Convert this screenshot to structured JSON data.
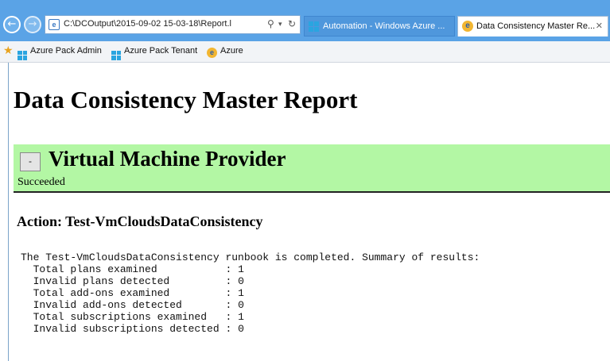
{
  "browser": {
    "address": "C:\\DCOutput\\2015-09-02 15-03-18\\Report.l",
    "tabs": [
      {
        "label": "Automation - Windows Azure ...",
        "active": false,
        "icon": "azure-icon"
      },
      {
        "label": "Data Consistency Master Re...",
        "active": true,
        "icon": "ie-page-icon"
      }
    ],
    "favorites": [
      {
        "label": "Azure Pack Admin",
        "icon": "azure-icon"
      },
      {
        "label": "Azure Pack Tenant",
        "icon": "azure-icon"
      },
      {
        "label": "Azure",
        "icon": "ie-page-icon"
      }
    ]
  },
  "report": {
    "title": "Data Consistency Master Report",
    "provider": {
      "toggle_label": "-",
      "title": "Virtual Machine Provider",
      "status": "Succeeded",
      "background": "#b3f7a4"
    },
    "action": {
      "heading": "Action: Test-VmCloudsDataConsistency",
      "summary_intro": "The Test-VmCloudsDataConsistency runbook is completed. Summary of results:",
      "results": [
        {
          "label": "Total plans examined",
          "value": "1"
        },
        {
          "label": "Invalid plans detected",
          "value": "0"
        },
        {
          "label": "Total add-ons examined",
          "value": "1"
        },
        {
          "label": "Invalid add-ons detected",
          "value": "0"
        },
        {
          "label": "Total subscriptions examined",
          "value": "1"
        },
        {
          "label": "Invalid subscriptions detected",
          "value": "0"
        }
      ]
    }
  }
}
